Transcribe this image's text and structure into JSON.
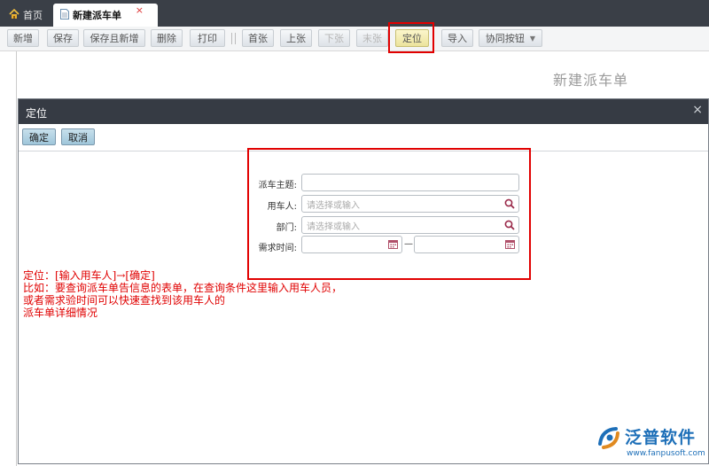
{
  "tabs": [
    {
      "label": "首页",
      "icon": "home-icon"
    },
    {
      "label": "新建派车单",
      "icon": "document-icon",
      "close": "×"
    }
  ],
  "toolbar": {
    "add": "新增",
    "save": "保存",
    "save_new": "保存且新增",
    "delete": "删除",
    "print": "打印",
    "first": "首张",
    "prev": "上张",
    "next": "下张",
    "last": "末张",
    "locate": "定位",
    "import": "导入",
    "coop": "协同按钮"
  },
  "page": {
    "title": "新建派车单"
  },
  "dialog": {
    "title": "定位",
    "close": "×",
    "ok": "确定",
    "cancel": "取消",
    "form": {
      "subject_label": "派车主题:",
      "subject_value": "",
      "user_label": "用车人:",
      "user_placeholder": "请选择或输入",
      "dept_label": "部门:",
      "dept_placeholder": "请选择或输入",
      "time_label": "需求时间:",
      "time_separator": "—"
    }
  },
  "annotation": {
    "line1": "定位：[输入用车人]→[确定]",
    "line2": "比如：要查询派车单告信息的表单，在查询条件这里输入用车人员，",
    "line3": "或者需求验时间可以快速查找到该用车人的",
    "line4": "派车单详细情况"
  },
  "logo": {
    "name": "泛普软件",
    "url": "www.fanpusoft.com"
  },
  "colors": {
    "highlight_red": "#e10000",
    "annotation_red": "#e00000",
    "dialog_header": "#363b44",
    "tab_bar": "#3a3f47",
    "brand_blue": "#1d6fb8"
  }
}
